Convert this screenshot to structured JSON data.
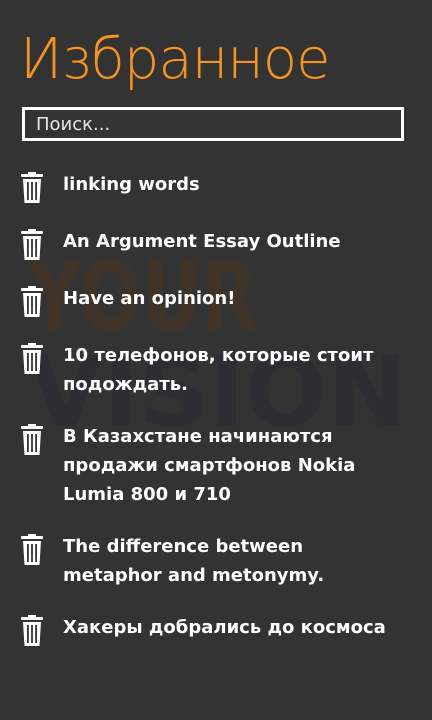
{
  "page": {
    "title": "Избранное"
  },
  "search": {
    "placeholder": "Поиск..."
  },
  "watermark": {
    "line1": "YOUR",
    "line2": "VISION"
  },
  "favorites": [
    {
      "title": "linking words",
      "icon": "trash-icon"
    },
    {
      "title": "An Argument Essay Outline",
      "icon": "trash-icon"
    },
    {
      "title": "Have an opinion!",
      "icon": "trash-icon"
    },
    {
      "title": "10 телефонов, которые стоит подождать.",
      "icon": "trash-icon"
    },
    {
      "title": "В Казахстане начинаются продажи смартфонов Nokia Lumia 800 и 710",
      "icon": "trash-icon"
    },
    {
      "title": "The difference between metaphor and metonymy.",
      "icon": "trash-icon"
    },
    {
      "title": "Хакеры добрались до космоса",
      "icon": "trash-icon"
    }
  ],
  "colors": {
    "background": "#333333",
    "accent": "#f7941d",
    "text": "#ffffff",
    "watermark": "#5a3a1a"
  }
}
